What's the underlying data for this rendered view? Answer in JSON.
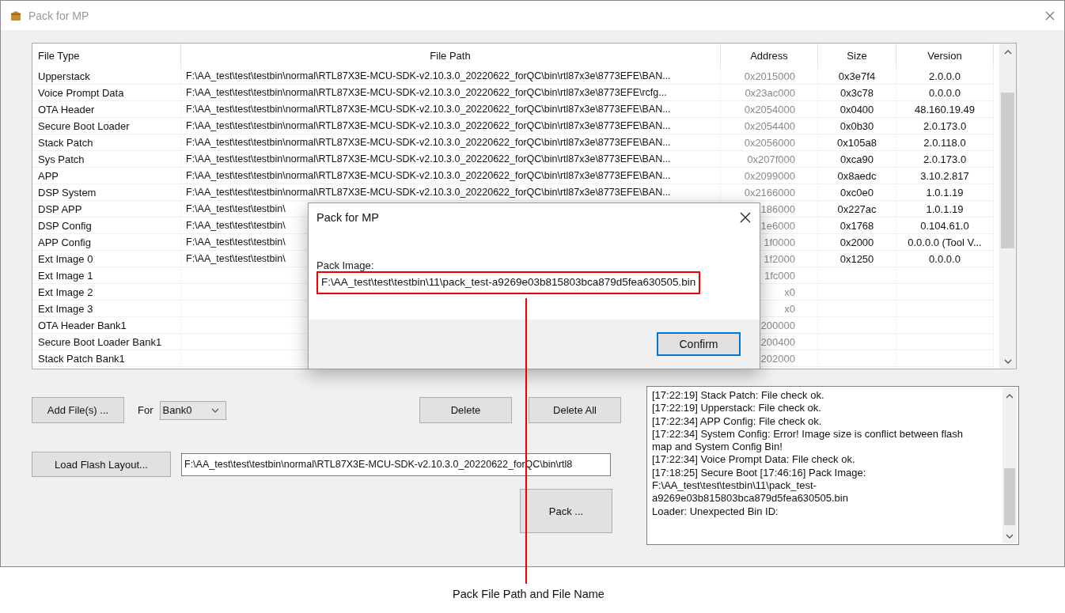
{
  "window": {
    "title": "Pack for MP"
  },
  "table": {
    "columns": [
      "File Type",
      "File Path",
      "Address",
      "Size",
      "Version"
    ],
    "rows": [
      {
        "file_type": "Upperstack",
        "file_path": "F:\\AA_test\\test\\testbin\\normal\\RTL87X3E-MCU-SDK-v2.10.3.0_20220622_forQC\\bin\\rtl87x3e\\8773EFE\\BAN...",
        "address": "0x2015000",
        "size": "0x3e7f4",
        "version": "2.0.0.0"
      },
      {
        "file_type": "Voice Prompt Data",
        "file_path": "F:\\AA_test\\test\\testbin\\normal\\RTL87X3E-MCU-SDK-v2.10.3.0_20220622_forQC\\bin\\rtl87x3e\\8773EFE\\rcfg...",
        "address": "0x23ac000",
        "size": "0x3c78",
        "version": "0.0.0.0"
      },
      {
        "file_type": "OTA Header",
        "file_path": "F:\\AA_test\\test\\testbin\\normal\\RTL87X3E-MCU-SDK-v2.10.3.0_20220622_forQC\\bin\\rtl87x3e\\8773EFE\\BAN...",
        "address": "0x2054000",
        "size": "0x0400",
        "version": "48.160.19.49"
      },
      {
        "file_type": "Secure Boot Loader",
        "file_path": "F:\\AA_test\\test\\testbin\\normal\\RTL87X3E-MCU-SDK-v2.10.3.0_20220622_forQC\\bin\\rtl87x3e\\8773EFE\\BAN...",
        "address": "0x2054400",
        "size": "0x0b30",
        "version": "2.0.173.0"
      },
      {
        "file_type": "Stack Patch",
        "file_path": "F:\\AA_test\\test\\testbin\\normal\\RTL87X3E-MCU-SDK-v2.10.3.0_20220622_forQC\\bin\\rtl87x3e\\8773EFE\\BAN...",
        "address": "0x2056000",
        "size": "0x105a8",
        "version": "2.0.118.0"
      },
      {
        "file_type": "Sys Patch",
        "file_path": "F:\\AA_test\\test\\testbin\\normal\\RTL87X3E-MCU-SDK-v2.10.3.0_20220622_forQC\\bin\\rtl87x3e\\8773EFE\\BAN...",
        "address": "0x207f000",
        "size": "0xca90",
        "version": "2.0.173.0"
      },
      {
        "file_type": "APP",
        "file_path": "F:\\AA_test\\test\\testbin\\normal\\RTL87X3E-MCU-SDK-v2.10.3.0_20220622_forQC\\bin\\rtl87x3e\\8773EFE\\BAN...",
        "address": "0x2099000",
        "size": "0x8aedc",
        "version": "3.10.2.817"
      },
      {
        "file_type": "DSP System",
        "file_path": "F:\\AA_test\\test\\testbin\\normal\\RTL87X3E-MCU-SDK-v2.10.3.0_20220622_forQC\\bin\\rtl87x3e\\8773EFE\\BAN...",
        "address": "0x2166000",
        "size": "0xc0e0",
        "version": "1.0.1.19"
      },
      {
        "file_type": "DSP APP",
        "file_path": "F:\\AA_test\\test\\testbin\\",
        "address": "186000",
        "size": "0x227ac",
        "version": "1.0.1.19"
      },
      {
        "file_type": "DSP Config",
        "file_path": "F:\\AA_test\\test\\testbin\\",
        "address": "1e6000",
        "size": "0x1768",
        "version": "0.104.61.0"
      },
      {
        "file_type": "APP Config",
        "file_path": "F:\\AA_test\\test\\testbin\\",
        "address": "1f0000",
        "size": "0x2000",
        "version": "0.0.0.0 (Tool V..."
      },
      {
        "file_type": "Ext Image 0",
        "file_path": "F:\\AA_test\\test\\testbin\\",
        "address": "1f2000",
        "size": "0x1250",
        "version": "0.0.0.0"
      },
      {
        "file_type": "Ext Image 1",
        "address": "1fc000"
      },
      {
        "file_type": "Ext Image 2",
        "address": "x0"
      },
      {
        "file_type": "Ext Image 3",
        "address": "x0"
      },
      {
        "file_type": "OTA Header Bank1",
        "address": "200000"
      },
      {
        "file_type": "Secure Boot Loader Bank1",
        "address": "200400"
      },
      {
        "file_type": "Stack Patch Bank1",
        "address": "202000"
      }
    ]
  },
  "add_button": "Add File(s) ...",
  "bank": {
    "label": "For",
    "value": "Bank0"
  },
  "delete_button": "Delete",
  "delete_all_button": "Delete All",
  "load_button": "Load Flash Layout...",
  "layout_path": "F:\\AA_test\\test\\testbin\\normal\\RTL87X3E-MCU-SDK-v2.10.3.0_20220622_forQC\\bin\\rtl8",
  "pack_button": "Pack ...",
  "log": [
    "[17:22:19] Stack Patch: File check ok.",
    "[17:22:19] Upperstack: File check ok.",
    "[17:22:34] APP Config: File check ok.",
    "[17:22:34] System Config: Error! Image size is conflict between flash map and System Config Bin!",
    "[17:22:34] Voice Prompt Data: File check ok.",
    "[17:18:25] Secure Boot [17:46:16] Pack Image: F:\\AA_test\\test\\testbin\\11\\pack_test-a9269e03b815803bca879d5fea630505.bin",
    "Loader: Unexpected Bin ID:"
  ],
  "dialog": {
    "title": "Pack for MP",
    "label": "Pack Image:",
    "path": "F:\\AA_test\\test\\testbin\\11\\pack_test-a9269e03b815803bca879d5fea630505.bin",
    "button": "Confirm"
  },
  "annotation": "Pack File Path and File Name"
}
